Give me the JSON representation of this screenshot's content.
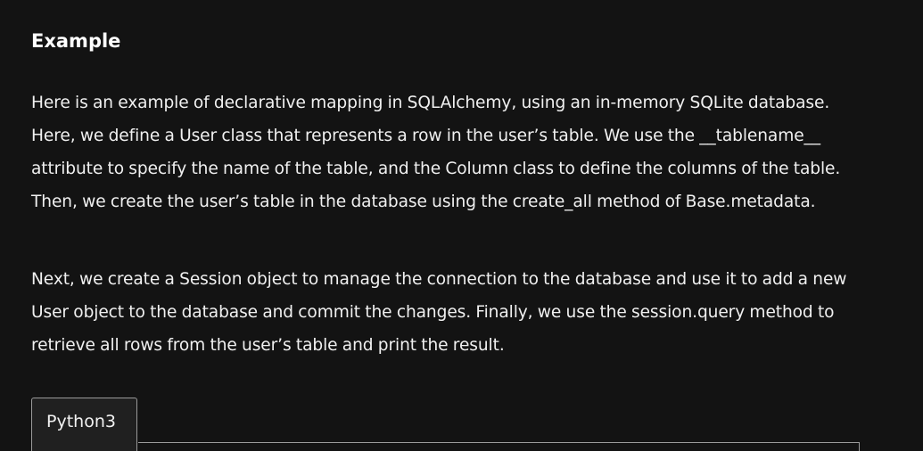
{
  "article": {
    "heading": "Example",
    "paragraphs": [
      "Here is an example of declarative mapping in SQLAlchemy, using an in-memory SQLite database. Here, we define a User class that represents a row in the user’s table. We use the __tablename__ attribute to specify the name of the table, and the Column class to define the columns of the table. Then, we create the user’s table in the database using the create_all method of Base.metadata.",
      "Next, we create a Session object to manage the connection to the database and use it to add a new User object to the database and commit the changes. Finally, we use the session.query method to retrieve all rows from the user’s table and print the result."
    ]
  },
  "code_tabs": {
    "active": "Python3",
    "tabs": [
      "Python3"
    ]
  },
  "colors": {
    "background": "#131313",
    "text": "#f0f0f0",
    "tab_border": "#9a9a9a"
  }
}
